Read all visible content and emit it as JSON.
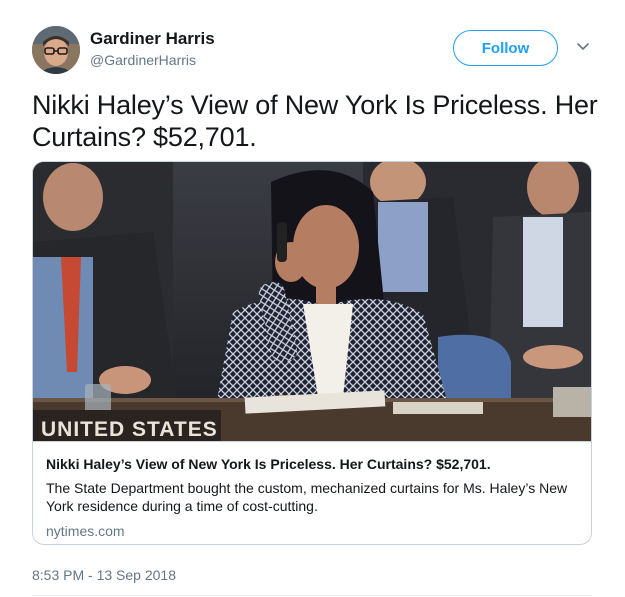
{
  "author": {
    "name": "Gardiner Harris",
    "handle": "@GardinerHarris"
  },
  "actions": {
    "follow_label": "Follow"
  },
  "tweet": {
    "text": "Nikki Haley’s View of New York Is Priceless. Her Curtains? $52,701.",
    "timestamp": "8:53 PM - 13 Sep 2018"
  },
  "card": {
    "image_sign_text": "UNITED STATES",
    "title": "Nikki Haley’s View of New York Is Priceless. Her Curtains? $52,701.",
    "description": "The State Department bought the custom, mechanized curtains for Ms. Haley’s New York residence during a time of cost-cutting.",
    "domain": "nytimes.com"
  },
  "colors": {
    "accent": "#1da1f2",
    "text_primary": "#14171a",
    "text_secondary": "#657786",
    "border": "#c8d2da"
  },
  "icons": {
    "caret": "chevron-down-icon"
  }
}
